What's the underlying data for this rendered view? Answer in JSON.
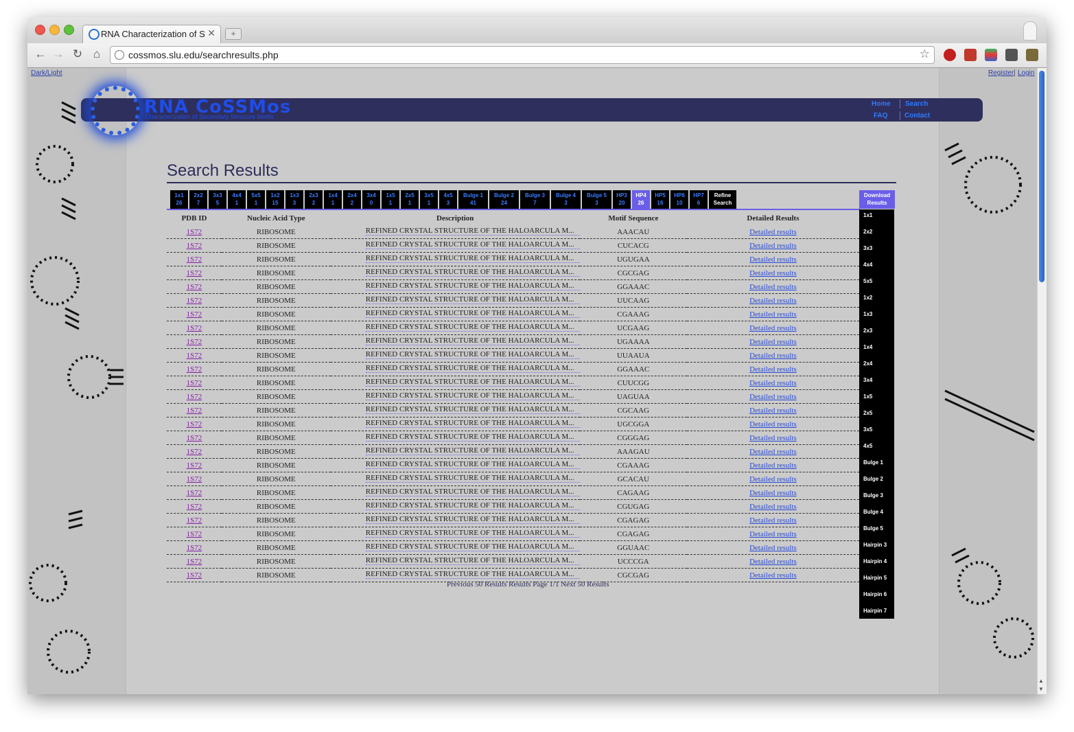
{
  "browser": {
    "tab_title": "RNA Characterization of Seco",
    "tab_close": "✕",
    "new_tab": "+",
    "url": "cossmos.slu.edu/searchresults.php",
    "back": "←",
    "forward": "→",
    "reload": "↻",
    "home": "⌂",
    "star": "☆"
  },
  "site": {
    "dark_light": "Dark/Light",
    "register": "Register",
    "login": "Login",
    "logo_text": "RNA CoSSMos",
    "logo_sub": "Characterization of Secondary Structure Motifs",
    "nav": {
      "home": "Home",
      "search": "Search",
      "faq": "FAQ",
      "contact": "Contact"
    },
    "page_title": "Search Results"
  },
  "filters": [
    {
      "label": "1x1",
      "count": "26"
    },
    {
      "label": "2x2",
      "count": "7"
    },
    {
      "label": "3x3",
      "count": "5"
    },
    {
      "label": "4x4",
      "count": "1"
    },
    {
      "label": "5x5",
      "count": "1"
    },
    {
      "label": "1x2",
      "count": "15"
    },
    {
      "label": "1x3",
      "count": "3"
    },
    {
      "label": "2x3",
      "count": "2"
    },
    {
      "label": "1x4",
      "count": "1"
    },
    {
      "label": "2x4",
      "count": "2"
    },
    {
      "label": "3x4",
      "count": "0"
    },
    {
      "label": "1x5",
      "count": "1"
    },
    {
      "label": "2x5",
      "count": "1"
    },
    {
      "label": "3x5",
      "count": "1"
    },
    {
      "label": "4x5",
      "count": "3"
    },
    {
      "label": "Bulge 1",
      "count": "41"
    },
    {
      "label": "Bulge 2",
      "count": "24"
    },
    {
      "label": "Bulge 3",
      "count": "7"
    },
    {
      "label": "Bulge 4",
      "count": "3"
    },
    {
      "label": "Bulge 5",
      "count": "3"
    },
    {
      "label": "HP3",
      "count": "20"
    },
    {
      "label": "HP4",
      "count": "26"
    },
    {
      "label": "HP5",
      "count": "16"
    },
    {
      "label": "HP6",
      "count": "10"
    },
    {
      "label": "HP7",
      "count": "6"
    }
  ],
  "refine": {
    "line1": "Refine",
    "line2": "Search"
  },
  "download": {
    "line1": "Download",
    "line2": "Results"
  },
  "download_list": [
    "1x1",
    "2x2",
    "3x3",
    "4x4",
    "5x5",
    "1x2",
    "1x3",
    "2x3",
    "1x4",
    "2x4",
    "3x4",
    "1x5",
    "2x5",
    "3x5",
    "4x5",
    "Bulge 1",
    "Bulge 2",
    "Bulge 3",
    "Bulge 4",
    "Bulge 5",
    "Hairpin 3",
    "Hairpin 4",
    "Hairpin 5",
    "Hairpin 6",
    "Hairpin 7"
  ],
  "table": {
    "headers": [
      "PDB ID",
      "Nucleic Acid Type",
      "Description",
      "Motif Sequence",
      "Detailed Results"
    ],
    "rows": [
      {
        "pdb": "1S72",
        "type": "RIBOSOME",
        "desc": "REFINED CRYSTAL STRUCTURE OF THE HALOARCULA M...",
        "seq": "AAACAU",
        "det": "Detailed results"
      },
      {
        "pdb": "1S72",
        "type": "RIBOSOME",
        "desc": "REFINED CRYSTAL STRUCTURE OF THE HALOARCULA M...",
        "seq": "CUCACG",
        "det": "Detailed results"
      },
      {
        "pdb": "1S72",
        "type": "RIBOSOME",
        "desc": "REFINED CRYSTAL STRUCTURE OF THE HALOARCULA M...",
        "seq": "UGUGAA",
        "det": "Detailed results"
      },
      {
        "pdb": "1S72",
        "type": "RIBOSOME",
        "desc": "REFINED CRYSTAL STRUCTURE OF THE HALOARCULA M...",
        "seq": "CGCGAG",
        "det": "Detailed results"
      },
      {
        "pdb": "1S72",
        "type": "RIBOSOME",
        "desc": "REFINED CRYSTAL STRUCTURE OF THE HALOARCULA M...",
        "seq": "GGAAAC",
        "det": "Detailed results"
      },
      {
        "pdb": "1S72",
        "type": "RIBOSOME",
        "desc": "REFINED CRYSTAL STRUCTURE OF THE HALOARCULA M...",
        "seq": "UUCAAG",
        "det": "Detailed results"
      },
      {
        "pdb": "1S72",
        "type": "RIBOSOME",
        "desc": "REFINED CRYSTAL STRUCTURE OF THE HALOARCULA M...",
        "seq": "CGAAAG",
        "det": "Detailed results"
      },
      {
        "pdb": "1S72",
        "type": "RIBOSOME",
        "desc": "REFINED CRYSTAL STRUCTURE OF THE HALOARCULA M...",
        "seq": "UCGAAG",
        "det": "Detailed results"
      },
      {
        "pdb": "1S72",
        "type": "RIBOSOME",
        "desc": "REFINED CRYSTAL STRUCTURE OF THE HALOARCULA M...",
        "seq": "UGAAAA",
        "det": "Detailed results"
      },
      {
        "pdb": "1S72",
        "type": "RIBOSOME",
        "desc": "REFINED CRYSTAL STRUCTURE OF THE HALOARCULA M...",
        "seq": "UUAAUA",
        "det": "Detailed results"
      },
      {
        "pdb": "1S72",
        "type": "RIBOSOME",
        "desc": "REFINED CRYSTAL STRUCTURE OF THE HALOARCULA M...",
        "seq": "GGAAAC",
        "det": "Detailed results"
      },
      {
        "pdb": "1S72",
        "type": "RIBOSOME",
        "desc": "REFINED CRYSTAL STRUCTURE OF THE HALOARCULA M...",
        "seq": "CUUCGG",
        "det": "Detailed results"
      },
      {
        "pdb": "1S72",
        "type": "RIBOSOME",
        "desc": "REFINED CRYSTAL STRUCTURE OF THE HALOARCULA M...",
        "seq": "UAGUAA",
        "det": "Detailed results"
      },
      {
        "pdb": "1S72",
        "type": "RIBOSOME",
        "desc": "REFINED CRYSTAL STRUCTURE OF THE HALOARCULA M...",
        "seq": "CGCAAG",
        "det": "Detailed results"
      },
      {
        "pdb": "1S72",
        "type": "RIBOSOME",
        "desc": "REFINED CRYSTAL STRUCTURE OF THE HALOARCULA M...",
        "seq": "UGCGGA",
        "det": "Detailed results"
      },
      {
        "pdb": "1S72",
        "type": "RIBOSOME",
        "desc": "REFINED CRYSTAL STRUCTURE OF THE HALOARCULA M...",
        "seq": "CGGGAG",
        "det": "Detailed results"
      },
      {
        "pdb": "1S72",
        "type": "RIBOSOME",
        "desc": "REFINED CRYSTAL STRUCTURE OF THE HALOARCULA M...",
        "seq": "AAAGAU",
        "det": "Detailed results"
      },
      {
        "pdb": "1S72",
        "type": "RIBOSOME",
        "desc": "REFINED CRYSTAL STRUCTURE OF THE HALOARCULA M...",
        "seq": "CGAAAG",
        "det": "Detailed results"
      },
      {
        "pdb": "1S72",
        "type": "RIBOSOME",
        "desc": "REFINED CRYSTAL STRUCTURE OF THE HALOARCULA M...",
        "seq": "GCACAU",
        "det": "Detailed results"
      },
      {
        "pdb": "1S72",
        "type": "RIBOSOME",
        "desc": "REFINED CRYSTAL STRUCTURE OF THE HALOARCULA M...",
        "seq": "CAGAAG",
        "det": "Detailed results"
      },
      {
        "pdb": "1S72",
        "type": "RIBOSOME",
        "desc": "REFINED CRYSTAL STRUCTURE OF THE HALOARCULA M...",
        "seq": "CGUGAG",
        "det": "Detailed results"
      },
      {
        "pdb": "1S72",
        "type": "RIBOSOME",
        "desc": "REFINED CRYSTAL STRUCTURE OF THE HALOARCULA M...",
        "seq": "CGAGAG",
        "det": "Detailed results"
      },
      {
        "pdb": "1S72",
        "type": "RIBOSOME",
        "desc": "REFINED CRYSTAL STRUCTURE OF THE HALOARCULA M...",
        "seq": "CGAGAG",
        "det": "Detailed results"
      },
      {
        "pdb": "1S72",
        "type": "RIBOSOME",
        "desc": "REFINED CRYSTAL STRUCTURE OF THE HALOARCULA M...",
        "seq": "GGUAAC",
        "det": "Detailed results"
      },
      {
        "pdb": "1S72",
        "type": "RIBOSOME",
        "desc": "REFINED CRYSTAL STRUCTURE OF THE HALOARCULA M...",
        "seq": "UCCCGA",
        "det": "Detailed results"
      },
      {
        "pdb": "1S72",
        "type": "RIBOSOME",
        "desc": "REFINED CRYSTAL STRUCTURE OF THE HALOARCULA M...",
        "seq": "CGCGAG",
        "det": "Detailed results"
      }
    ]
  },
  "pager": "Previous 50 Results Results Page 1/1 Next 50 Results"
}
